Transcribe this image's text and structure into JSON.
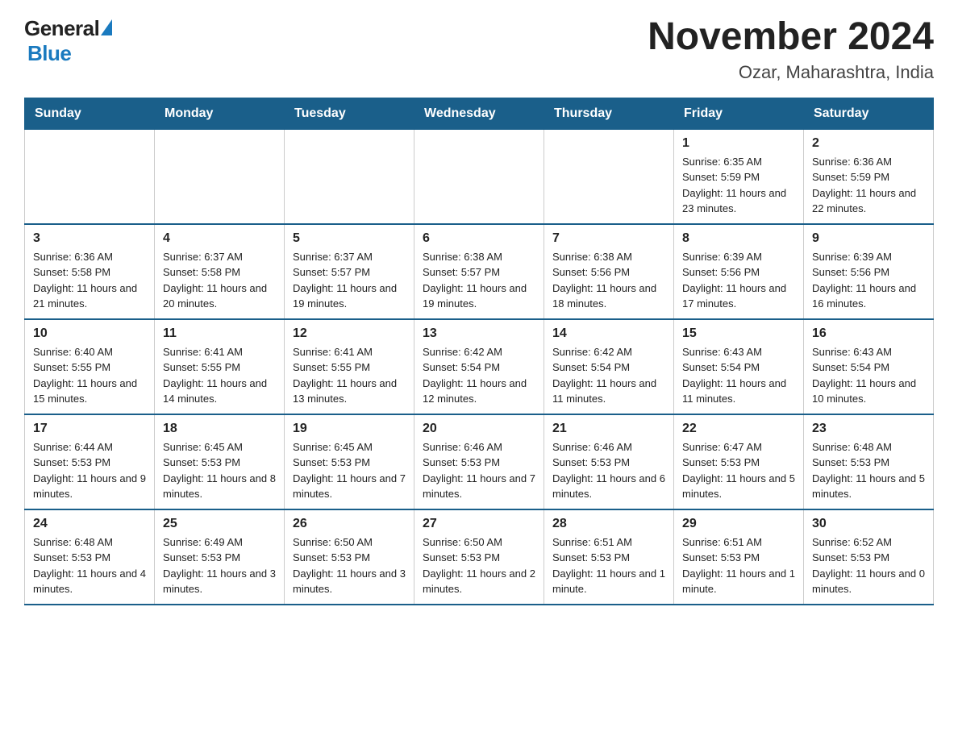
{
  "header": {
    "logo_general": "General",
    "logo_blue": "Blue",
    "month_title": "November 2024",
    "location": "Ozar, Maharashtra, India"
  },
  "days_of_week": [
    "Sunday",
    "Monday",
    "Tuesday",
    "Wednesday",
    "Thursday",
    "Friday",
    "Saturday"
  ],
  "weeks": [
    {
      "days": [
        {
          "num": "",
          "info": ""
        },
        {
          "num": "",
          "info": ""
        },
        {
          "num": "",
          "info": ""
        },
        {
          "num": "",
          "info": ""
        },
        {
          "num": "",
          "info": ""
        },
        {
          "num": "1",
          "info": "Sunrise: 6:35 AM\nSunset: 5:59 PM\nDaylight: 11 hours and 23 minutes."
        },
        {
          "num": "2",
          "info": "Sunrise: 6:36 AM\nSunset: 5:59 PM\nDaylight: 11 hours and 22 minutes."
        }
      ]
    },
    {
      "days": [
        {
          "num": "3",
          "info": "Sunrise: 6:36 AM\nSunset: 5:58 PM\nDaylight: 11 hours and 21 minutes."
        },
        {
          "num": "4",
          "info": "Sunrise: 6:37 AM\nSunset: 5:58 PM\nDaylight: 11 hours and 20 minutes."
        },
        {
          "num": "5",
          "info": "Sunrise: 6:37 AM\nSunset: 5:57 PM\nDaylight: 11 hours and 19 minutes."
        },
        {
          "num": "6",
          "info": "Sunrise: 6:38 AM\nSunset: 5:57 PM\nDaylight: 11 hours and 19 minutes."
        },
        {
          "num": "7",
          "info": "Sunrise: 6:38 AM\nSunset: 5:56 PM\nDaylight: 11 hours and 18 minutes."
        },
        {
          "num": "8",
          "info": "Sunrise: 6:39 AM\nSunset: 5:56 PM\nDaylight: 11 hours and 17 minutes."
        },
        {
          "num": "9",
          "info": "Sunrise: 6:39 AM\nSunset: 5:56 PM\nDaylight: 11 hours and 16 minutes."
        }
      ]
    },
    {
      "days": [
        {
          "num": "10",
          "info": "Sunrise: 6:40 AM\nSunset: 5:55 PM\nDaylight: 11 hours and 15 minutes."
        },
        {
          "num": "11",
          "info": "Sunrise: 6:41 AM\nSunset: 5:55 PM\nDaylight: 11 hours and 14 minutes."
        },
        {
          "num": "12",
          "info": "Sunrise: 6:41 AM\nSunset: 5:55 PM\nDaylight: 11 hours and 13 minutes."
        },
        {
          "num": "13",
          "info": "Sunrise: 6:42 AM\nSunset: 5:54 PM\nDaylight: 11 hours and 12 minutes."
        },
        {
          "num": "14",
          "info": "Sunrise: 6:42 AM\nSunset: 5:54 PM\nDaylight: 11 hours and 11 minutes."
        },
        {
          "num": "15",
          "info": "Sunrise: 6:43 AM\nSunset: 5:54 PM\nDaylight: 11 hours and 11 minutes."
        },
        {
          "num": "16",
          "info": "Sunrise: 6:43 AM\nSunset: 5:54 PM\nDaylight: 11 hours and 10 minutes."
        }
      ]
    },
    {
      "days": [
        {
          "num": "17",
          "info": "Sunrise: 6:44 AM\nSunset: 5:53 PM\nDaylight: 11 hours and 9 minutes."
        },
        {
          "num": "18",
          "info": "Sunrise: 6:45 AM\nSunset: 5:53 PM\nDaylight: 11 hours and 8 minutes."
        },
        {
          "num": "19",
          "info": "Sunrise: 6:45 AM\nSunset: 5:53 PM\nDaylight: 11 hours and 7 minutes."
        },
        {
          "num": "20",
          "info": "Sunrise: 6:46 AM\nSunset: 5:53 PM\nDaylight: 11 hours and 7 minutes."
        },
        {
          "num": "21",
          "info": "Sunrise: 6:46 AM\nSunset: 5:53 PM\nDaylight: 11 hours and 6 minutes."
        },
        {
          "num": "22",
          "info": "Sunrise: 6:47 AM\nSunset: 5:53 PM\nDaylight: 11 hours and 5 minutes."
        },
        {
          "num": "23",
          "info": "Sunrise: 6:48 AM\nSunset: 5:53 PM\nDaylight: 11 hours and 5 minutes."
        }
      ]
    },
    {
      "days": [
        {
          "num": "24",
          "info": "Sunrise: 6:48 AM\nSunset: 5:53 PM\nDaylight: 11 hours and 4 minutes."
        },
        {
          "num": "25",
          "info": "Sunrise: 6:49 AM\nSunset: 5:53 PM\nDaylight: 11 hours and 3 minutes."
        },
        {
          "num": "26",
          "info": "Sunrise: 6:50 AM\nSunset: 5:53 PM\nDaylight: 11 hours and 3 minutes."
        },
        {
          "num": "27",
          "info": "Sunrise: 6:50 AM\nSunset: 5:53 PM\nDaylight: 11 hours and 2 minutes."
        },
        {
          "num": "28",
          "info": "Sunrise: 6:51 AM\nSunset: 5:53 PM\nDaylight: 11 hours and 1 minute."
        },
        {
          "num": "29",
          "info": "Sunrise: 6:51 AM\nSunset: 5:53 PM\nDaylight: 11 hours and 1 minute."
        },
        {
          "num": "30",
          "info": "Sunrise: 6:52 AM\nSunset: 5:53 PM\nDaylight: 11 hours and 0 minutes."
        }
      ]
    }
  ]
}
